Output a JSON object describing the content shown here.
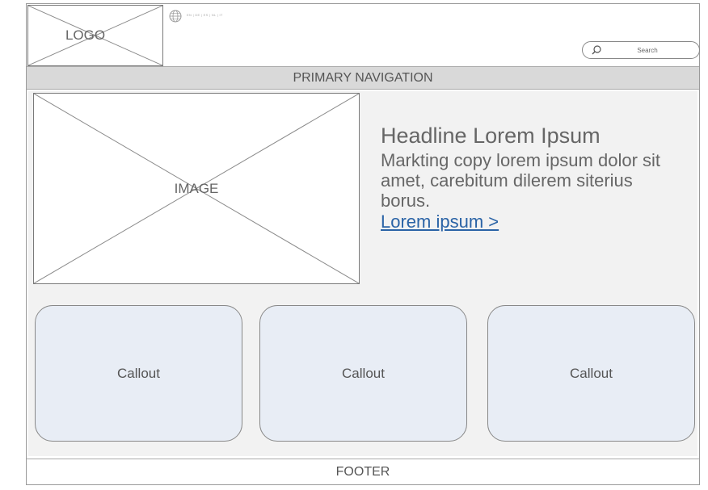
{
  "header": {
    "logo_label": "LOGO",
    "languages": "EN | DE | ES | NL | IT",
    "search_placeholder": "Search"
  },
  "nav": {
    "label": "PRIMARY NAVIGATION"
  },
  "hero": {
    "image_label": "IMAGE",
    "headline": "Headline Lorem Ipsum",
    "copy": "Markting copy lorem ipsum dolor sit amet, carebitum dilerem siterius borus.",
    "cta": "Lorem ipsum >"
  },
  "callouts": [
    {
      "label": "Callout"
    },
    {
      "label": "Callout"
    },
    {
      "label": "Callout"
    }
  ],
  "footer": {
    "label": "FOOTER"
  },
  "colors": {
    "link": "#2a63a6",
    "nav_bg": "#d9d9d9",
    "callout_bg": "#e8edf5"
  }
}
